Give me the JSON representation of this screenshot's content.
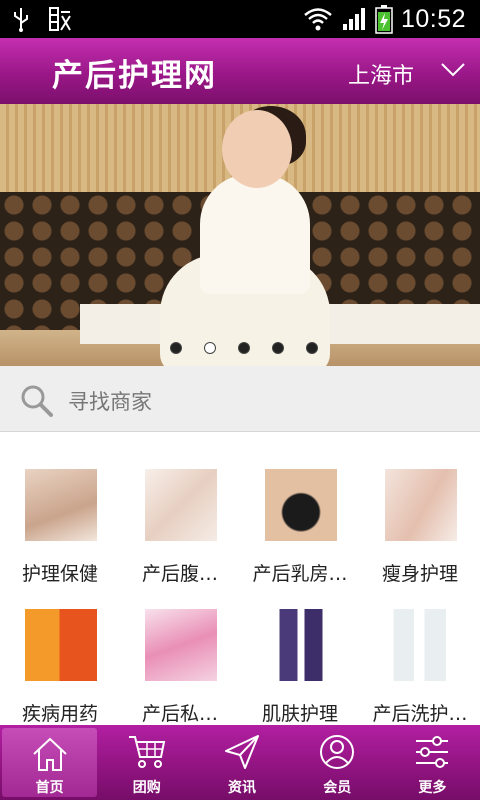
{
  "status_bar": {
    "time": "10:52"
  },
  "header": {
    "title": "产后护理网",
    "city": "上海市"
  },
  "banner": {
    "slide_count": 5,
    "active_slide": 3
  },
  "search": {
    "placeholder": "寻找商家"
  },
  "categories": [
    {
      "label": "护理保健",
      "icon": "massage-image"
    },
    {
      "label": "产后腹…",
      "icon": "abdomen-image"
    },
    {
      "label": "产后乳房…",
      "icon": "breast-care-image"
    },
    {
      "label": "瘦身护理",
      "icon": "slimming-image"
    },
    {
      "label": "疾病用药",
      "icon": "medicine-image"
    },
    {
      "label": "产后私…",
      "icon": "private-care-image"
    },
    {
      "label": "肌肤护理",
      "icon": "skincare-image"
    },
    {
      "label": "产后洗护…",
      "icon": "cleansing-products-image"
    }
  ],
  "nav": {
    "items": [
      {
        "label": "首页",
        "icon": "home-icon"
      },
      {
        "label": "团购",
        "icon": "cart-icon"
      },
      {
        "label": "资讯",
        "icon": "send-icon"
      },
      {
        "label": "会员",
        "icon": "user-icon"
      },
      {
        "label": "更多",
        "icon": "sliders-icon"
      }
    ],
    "active": 0
  },
  "colors": {
    "brand": "#9a1788",
    "nav": "#8f137f",
    "search_bg": "#eeeeee"
  }
}
